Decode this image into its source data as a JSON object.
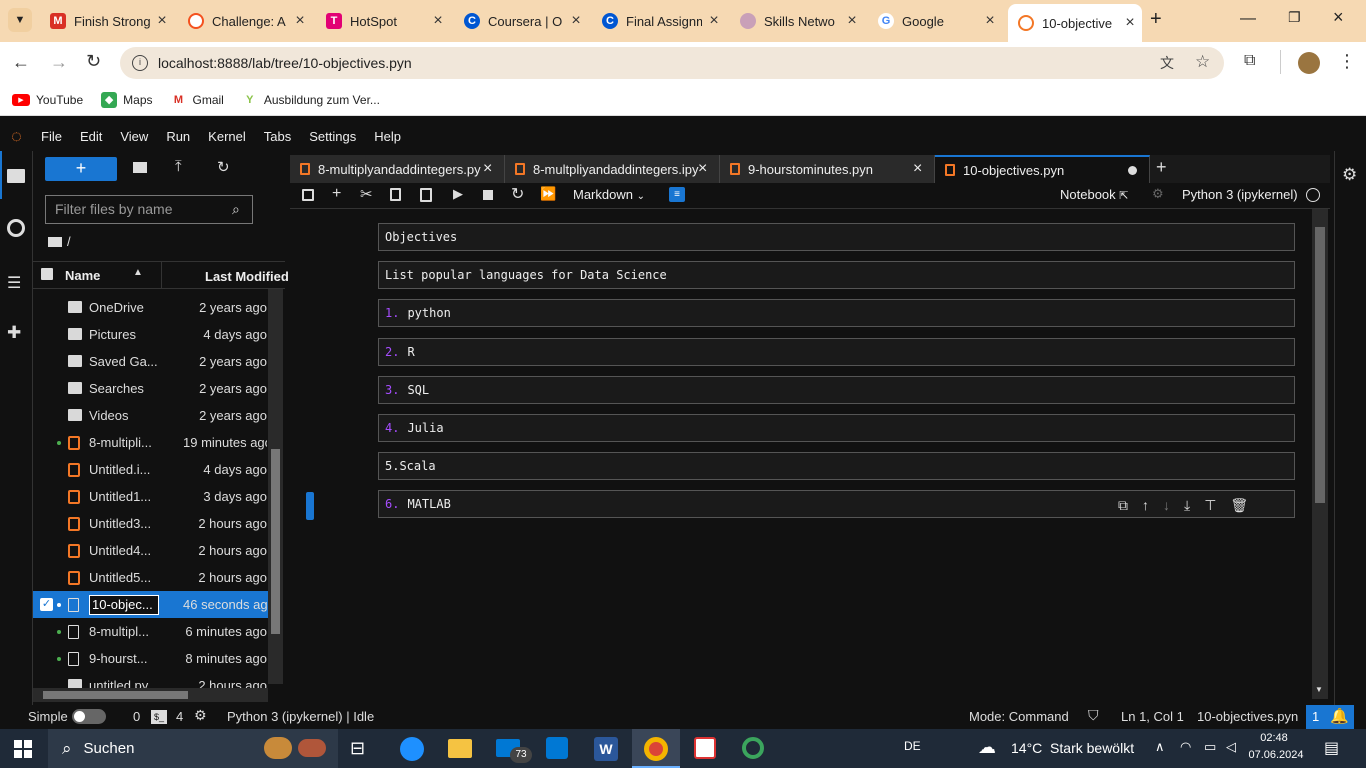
{
  "browser": {
    "tabs": [
      {
        "title": "Finish Strong",
        "icon": "gmail-icon",
        "color": "#d93025"
      },
      {
        "title": "Challenge: A",
        "icon": "circle-icon",
        "color": "#f4511e"
      },
      {
        "title": "HotSpot",
        "icon": "telekom-icon",
        "color": "#e20074"
      },
      {
        "title": "Coursera | O",
        "icon": "coursera-icon",
        "color": "#0056d2"
      },
      {
        "title": "Final Assignm",
        "icon": "coursera-icon",
        "color": "#0056d2"
      },
      {
        "title": "Skills Netwo",
        "icon": "skills-icon",
        "color": "#9b6b8b"
      },
      {
        "title": "Google",
        "icon": "google-icon",
        "color": "#4285f4"
      },
      {
        "title": "10-objective",
        "icon": "jupyter-icon",
        "color": "#f37726"
      }
    ],
    "url": "localhost:8888/lab/tree/10-objectives.pyn",
    "bookmarks": [
      "YouTube",
      "Maps",
      "Gmail",
      "Ausbildung zum Ver..."
    ]
  },
  "menu": [
    "File",
    "Edit",
    "View",
    "Run",
    "Kernel",
    "Tabs",
    "Settings",
    "Help"
  ],
  "filebrowser": {
    "new_label": "+",
    "filter_placeholder": "Filter files by name",
    "path": "/",
    "col_name": "Name",
    "col_modified": "Last Modified",
    "files": [
      {
        "name": "OneDrive",
        "modified": "2 years ago",
        "type": "folder",
        "running": false
      },
      {
        "name": "Pictures",
        "modified": "4 days ago",
        "type": "folder",
        "running": false
      },
      {
        "name": "Saved Ga...",
        "modified": "2 years ago",
        "type": "folder",
        "running": false
      },
      {
        "name": "Searches",
        "modified": "2 years ago",
        "type": "folder",
        "running": false
      },
      {
        "name": "Videos",
        "modified": "2 years ago",
        "type": "folder",
        "running": false
      },
      {
        "name": "8-multipli...",
        "modified": "19 minutes ago",
        "type": "notebook",
        "running": true
      },
      {
        "name": "Untitled.i...",
        "modified": "4 days ago",
        "type": "notebook",
        "running": false
      },
      {
        "name": "Untitled1...",
        "modified": "3 days ago",
        "type": "notebook",
        "running": false
      },
      {
        "name": "Untitled3...",
        "modified": "2 hours ago",
        "type": "notebook",
        "running": false
      },
      {
        "name": "Untitled4...",
        "modified": "2 hours ago",
        "type": "notebook",
        "running": false
      },
      {
        "name": "Untitled5...",
        "modified": "2 hours ago",
        "type": "notebook",
        "running": false
      },
      {
        "name": "10-objec...",
        "modified": "46 seconds ago",
        "type": "file",
        "running": true,
        "selected": true
      },
      {
        "name": "8-multipl...",
        "modified": "6 minutes ago",
        "type": "file",
        "running": true
      },
      {
        "name": "9-hourst...",
        "modified": "8 minutes ago",
        "type": "file",
        "running": true
      },
      {
        "name": "untitled.py",
        "modified": "2 hours ago",
        "type": "python",
        "running": false
      }
    ]
  },
  "doc_tabs": [
    {
      "title": "8-multiplyandaddintegers.py",
      "active": false
    },
    {
      "title": "8-multpliyandaddintegers.ipy",
      "active": false
    },
    {
      "title": "9-hourstominutes.pyn",
      "active": false
    },
    {
      "title": "10-objectives.pyn",
      "active": true
    }
  ],
  "nb_toolbar": {
    "cell_type": "Markdown",
    "notebook_label": "Notebook",
    "kernel": "Python 3 (ipykernel)"
  },
  "cells": [
    {
      "num": "",
      "text": "Objectives"
    },
    {
      "num": "",
      "text": "List popular languages for Data Science"
    },
    {
      "num": "1.",
      "text": "python"
    },
    {
      "num": "2.",
      "text": "R"
    },
    {
      "num": "3.",
      "text": "SQL"
    },
    {
      "num": "4.",
      "text": "Julia"
    },
    {
      "num": "",
      "text": "5.Scala"
    },
    {
      "num": "6.",
      "text": "MATLAB"
    }
  ],
  "statusbar": {
    "simple": "Simple",
    "terminals": "0",
    "kernels": "4",
    "kernel_status": "Python 3 (ipykernel) | Idle",
    "mode": "Mode: Command",
    "position": "Ln 1, Col 1",
    "filename": "10-objectives.pyn",
    "notifications": "1"
  },
  "taskbar": {
    "search": "Suchen",
    "mail_badge": "73",
    "lang": "DE",
    "weather": "14°C  Stark bewölkt",
    "time": "02:48",
    "date": "07.06.2024"
  }
}
